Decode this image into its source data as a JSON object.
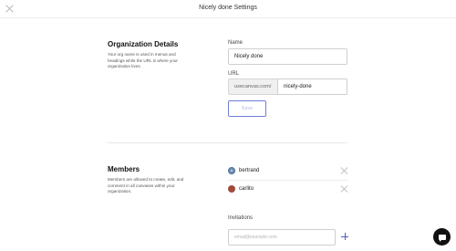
{
  "window": {
    "title": "Nicely done Settings"
  },
  "organization": {
    "title": "Organization Details",
    "description": "Your org name is used in menus and headings while the URL is where your organization lives.",
    "name_label": "Name",
    "name_value": "Nicely done",
    "url_label": "URL",
    "url_prefix": "usecanvas.com/",
    "url_value": "nicely-done",
    "save_label": "Save"
  },
  "members": {
    "title": "Members",
    "description": "Members are allowed to create, edit, and comment in all canvases within your organization.",
    "list": [
      {
        "name": "bertrand",
        "avatar_initials": "B"
      },
      {
        "name": "carlito"
      }
    ],
    "invitations_label": "Invitations",
    "invite_placeholder": "email@example.com"
  },
  "colors": {
    "accent": "#4b5fc9",
    "save_border": "#6f7fd9"
  },
  "icons": {
    "close": "close-icon",
    "remove": "remove-icon",
    "add": "plus-icon",
    "chat": "chat-icon"
  }
}
